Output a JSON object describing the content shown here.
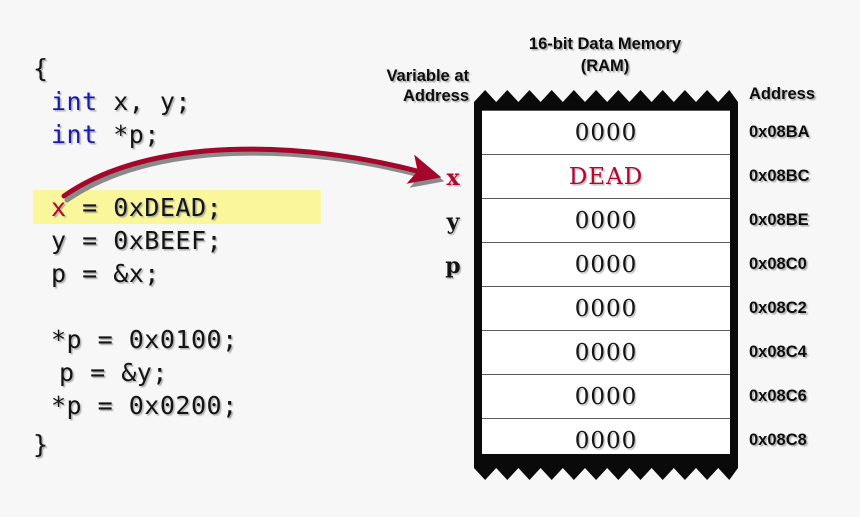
{
  "background_color": "#f7f7f7",
  "colors": {
    "keyword_blue": "#1a1aa8",
    "accent_red": "#b3062f",
    "highlight_yellow": "#faf69b",
    "text_black": "#141414",
    "box_black": "#0a0a0a"
  },
  "code": {
    "lines": [
      {
        "indent": 0,
        "text": "{",
        "parts": [
          {
            "t": "{",
            "c": "plain"
          }
        ]
      },
      {
        "indent": 18,
        "text": "int x, y;",
        "parts": [
          {
            "t": "int",
            "c": "kw"
          },
          {
            "t": " x, y;",
            "c": "plain"
          }
        ]
      },
      {
        "indent": 18,
        "text": "int *p;",
        "parts": [
          {
            "t": "int",
            "c": "kw"
          },
          {
            "t": " *p;",
            "c": "plain"
          }
        ]
      },
      {
        "indent": 0,
        "text": "",
        "parts": []
      },
      {
        "indent": 18,
        "text": "x = 0xDEAD;",
        "parts": [
          {
            "t": "x",
            "c": "red"
          },
          {
            "t": " = 0xDEAD;",
            "c": "plain"
          }
        ],
        "highlighted": true
      },
      {
        "indent": 18,
        "text": "y = 0xBEEF;",
        "parts": [
          {
            "t": "y = 0xBEEF;",
            "c": "plain"
          }
        ]
      },
      {
        "indent": 18,
        "text": "p = &x;",
        "parts": [
          {
            "t": "p = &x;",
            "c": "plain"
          }
        ]
      },
      {
        "indent": 0,
        "text": "",
        "parts": []
      },
      {
        "indent": 18,
        "text": "*p = 0x0100;",
        "parts": [
          {
            "t": "*p = 0x0100;",
            "c": "plain"
          }
        ]
      },
      {
        "indent": 26,
        "text": "p = &y;",
        "parts": [
          {
            "t": "p = &y;",
            "c": "plain"
          }
        ]
      },
      {
        "indent": 18,
        "text": "*p = 0x0200;",
        "parts": [
          {
            "t": "*p = 0x0200;",
            "c": "plain"
          }
        ]
      },
      {
        "indent": 0,
        "text": "}",
        "parts": [
          {
            "t": "}",
            "c": "plain"
          }
        ]
      }
    ],
    "highlighted_line": "x = 0xDEAD;"
  },
  "labels": {
    "memory_title_line1": "16-bit Data Memory",
    "memory_title_line2": "(RAM)",
    "variable_at_address_line1": "Variable at",
    "variable_at_address_line2": "Address",
    "address_header": "Address"
  },
  "memory": {
    "rows": [
      {
        "variable": "",
        "value": "0000",
        "address": "0x08BA",
        "accent": false
      },
      {
        "variable": "x",
        "value": "DEAD",
        "address": "0x08BC",
        "accent": true
      },
      {
        "variable": "y",
        "value": "0000",
        "address": "0x08BE",
        "accent": false
      },
      {
        "variable": "p",
        "value": "0000",
        "address": "0x08C0",
        "accent": false
      },
      {
        "variable": "",
        "value": "0000",
        "address": "0x08C2",
        "accent": false
      },
      {
        "variable": "",
        "value": "0000",
        "address": "0x08C4",
        "accent": false
      },
      {
        "variable": "",
        "value": "0000",
        "address": "0x08C6",
        "accent": false
      },
      {
        "variable": "",
        "value": "0000",
        "address": "0x08C8",
        "accent": false
      }
    ]
  },
  "annotation_arrow": {
    "icon": "curved-arrow-icon",
    "color": "#a4062c",
    "from": "x = 0xDEAD; statement",
    "to": "memory row x at 0x08BC"
  }
}
